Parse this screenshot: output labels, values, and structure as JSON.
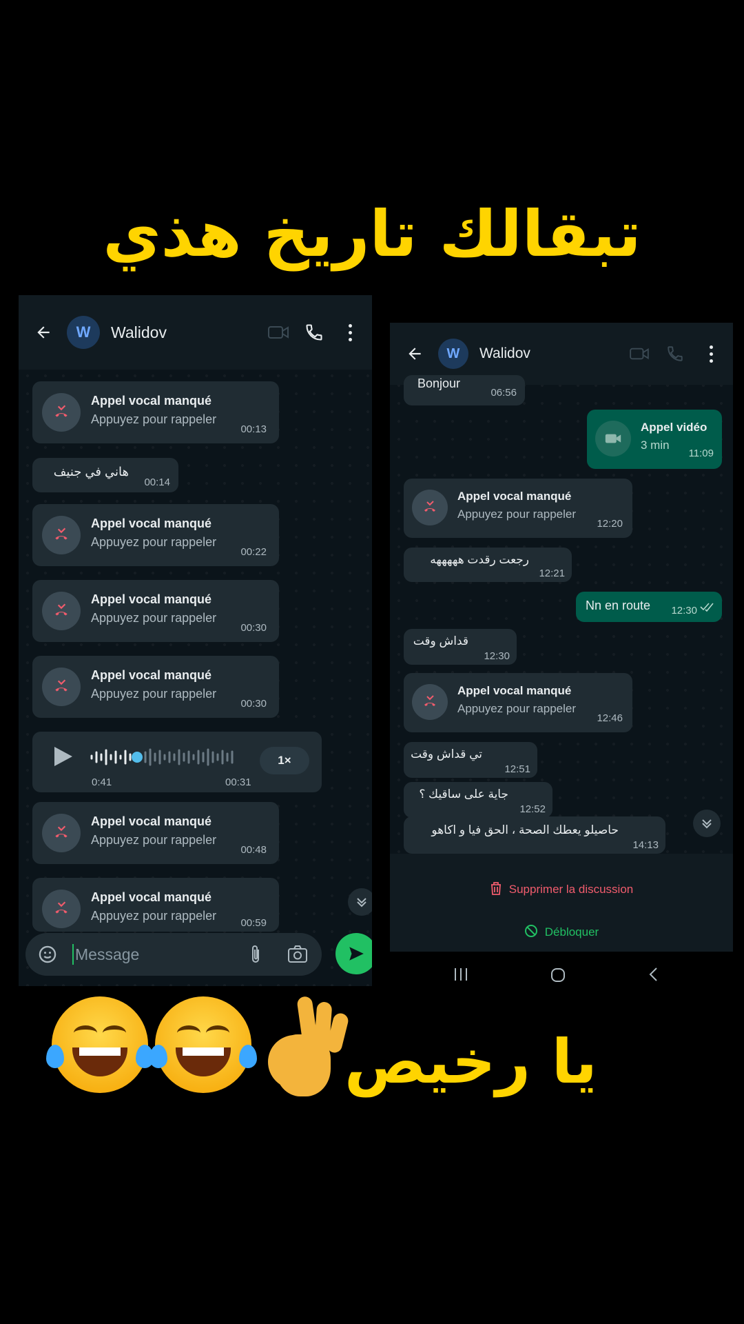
{
  "captions": {
    "top": "تبقالك تاريخ هذي",
    "bottom": "يا رخيص"
  },
  "emojis": [
    "face-with-tears-of-joy",
    "face-with-tears-of-joy",
    "ok-hand"
  ],
  "left_chat": {
    "contact": {
      "name": "Walidov",
      "avatar_letter": "W"
    },
    "messages": [
      {
        "type": "missed_call",
        "title": "Appel vocal manqué",
        "subtitle": "Appuyez pour rappeler",
        "time": "00:13"
      },
      {
        "type": "text",
        "text": "هاني في جنيف",
        "time": "00:14"
      },
      {
        "type": "missed_call",
        "title": "Appel vocal manqué",
        "subtitle": "Appuyez pour rappeler",
        "time": "00:22"
      },
      {
        "type": "missed_call",
        "title": "Appel vocal manqué",
        "subtitle": "Appuyez pour rappeler",
        "time": "00:30"
      },
      {
        "type": "missed_call",
        "title": "Appel vocal manqué",
        "subtitle": "Appuyez pour rappeler",
        "time": "00:30"
      },
      {
        "type": "voice",
        "duration": "0:41",
        "time": "00:31",
        "speed": "1×"
      },
      {
        "type": "missed_call",
        "title": "Appel vocal manqué",
        "subtitle": "Appuyez pour rappeler",
        "time": "00:48"
      },
      {
        "type": "missed_call",
        "title": "Appel vocal manqué",
        "subtitle": "Appuyez pour rappeler",
        "time": "00:59"
      }
    ],
    "input_placeholder": "Message"
  },
  "right_chat": {
    "contact": {
      "name": "Walidov",
      "avatar_letter": "W"
    },
    "messages": [
      {
        "type": "text",
        "text": "Bonjour",
        "time": "06:56"
      },
      {
        "type": "video_call",
        "title": "Appel vidéo",
        "subtitle": "3 min",
        "time": "11:09"
      },
      {
        "type": "missed_call",
        "title": "Appel vocal manqué",
        "subtitle": "Appuyez pour rappeler",
        "time": "12:20"
      },
      {
        "type": "text",
        "text": "رجعت رقدت هههههه",
        "time": "12:21"
      },
      {
        "type": "text_out",
        "text": "Nn en route",
        "time": "12:30"
      },
      {
        "type": "text",
        "text": "قداش وقت",
        "time": "12:30"
      },
      {
        "type": "missed_call",
        "title": "Appel vocal manqué",
        "subtitle": "Appuyez pour rappeler",
        "time": "12:46"
      },
      {
        "type": "text",
        "text": "تي قداش وقت",
        "time": "12:51"
      },
      {
        "type": "text",
        "text": "جاية على ساقيك ؟",
        "time": "12:52"
      },
      {
        "type": "text",
        "text": "حاصيلو يعطك الصحة ، الحق فيا و اكاهو",
        "time": "14:13"
      }
    ],
    "actions": {
      "delete": "Supprimer la discussion",
      "unblock": "Débloquer"
    }
  },
  "colors": {
    "caption": "#ffd400",
    "missed_call_icon": "#f15c6d",
    "delete_action": "#f15c6d",
    "unblock_action": "#21c063",
    "outgoing_bubble": "#005c4b",
    "incoming_bubble": "#202c33"
  }
}
